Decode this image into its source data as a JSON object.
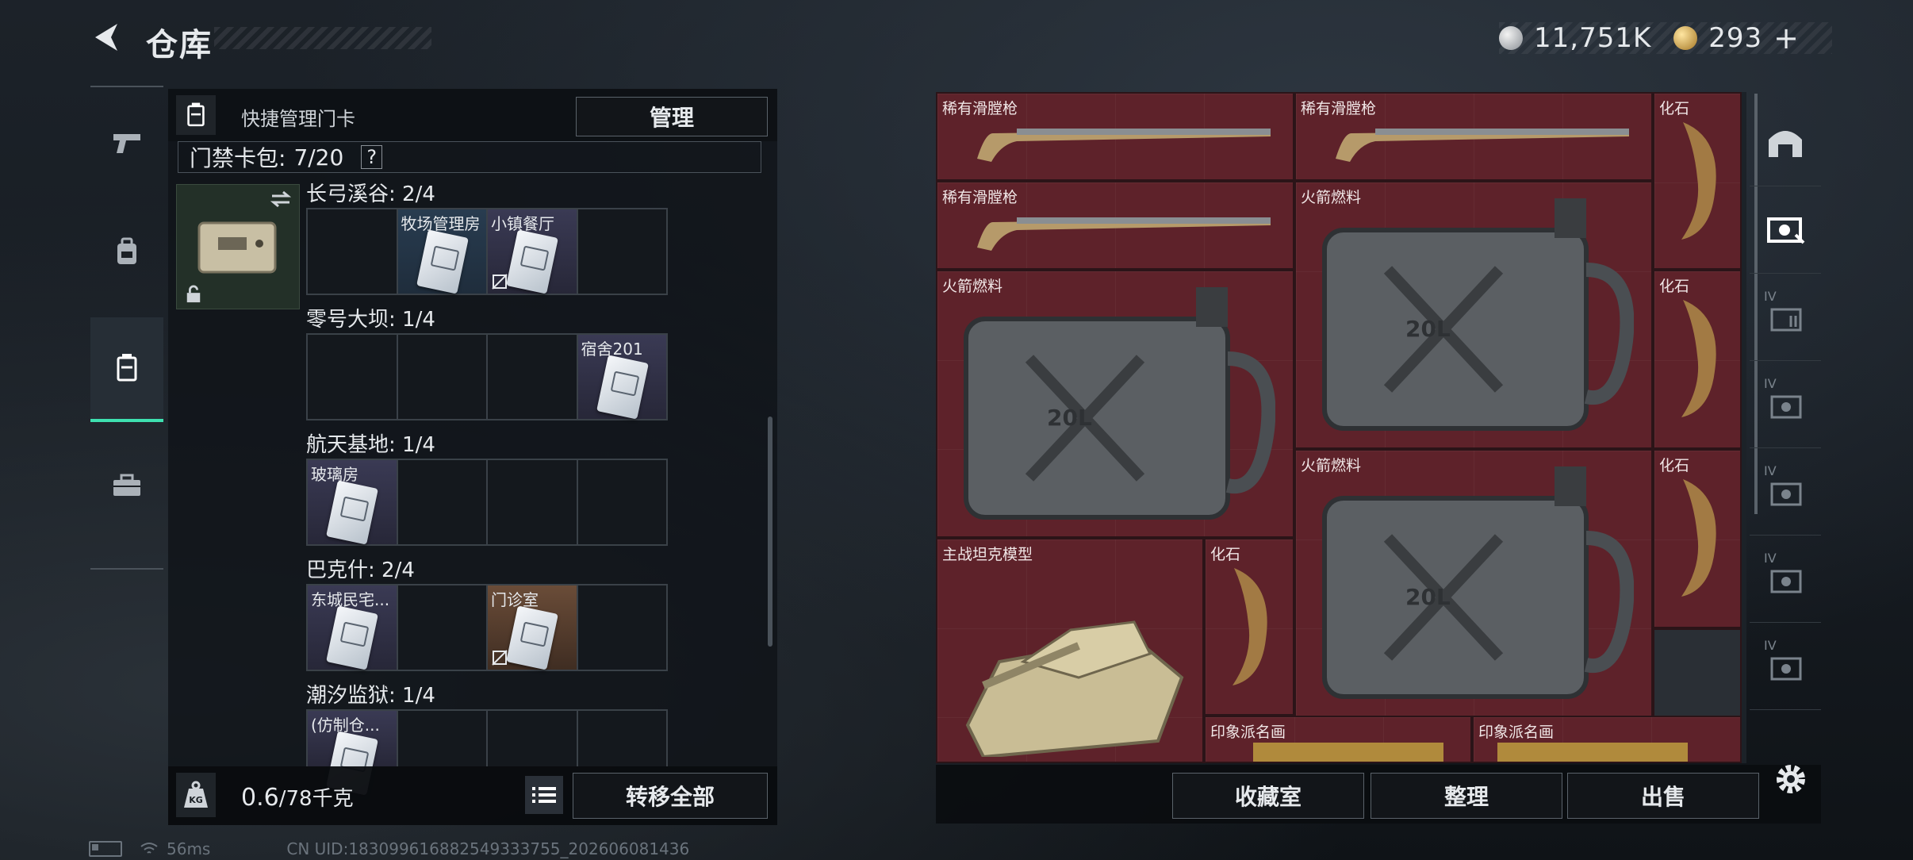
{
  "header": {
    "title": "仓库"
  },
  "currency": {
    "silver": "11,751K",
    "gold": "293",
    "add": "+"
  },
  "nav": {
    "items": [
      "weapons",
      "gear",
      "keycards",
      "toolbox"
    ],
    "active": "keycards"
  },
  "left_panel": {
    "header": "快捷管理门卡",
    "manage": "管理",
    "capacity_label": "门禁卡包:",
    "capacity_value": "7/20",
    "help": "?",
    "maps": [
      {
        "name": "长弓溪谷: 2/4",
        "slots": [
          "",
          "牧场管理房",
          "小镇餐厅",
          ""
        ]
      },
      {
        "name": "零号大坝: 1/4",
        "slots": [
          "",
          "",
          "",
          "宿舍201"
        ]
      },
      {
        "name": "航天基地: 1/4",
        "slots": [
          "玻璃房",
          "",
          "",
          ""
        ]
      },
      {
        "name": "巴克什: 2/4",
        "slots": [
          "东城民宅...",
          "",
          "门诊室",
          ""
        ]
      },
      {
        "name": "潮汐监狱: 1/4",
        "slots": [
          "(仿制仓...",
          "",
          "",
          ""
        ]
      }
    ],
    "weight_value": "0.6",
    "weight_total": "/78千克",
    "transfer_all": "转移全部"
  },
  "stash": {
    "items": {
      "gun1": "稀有滑膛枪",
      "gun2": "稀有滑膛枪",
      "gun3": "稀有滑膛枪",
      "fossil1": "化石",
      "fuel1": "火箭燃料",
      "fuel2": "火箭燃料",
      "fuel3": "火箭燃料",
      "fossil2": "化石",
      "fossil3": "化石",
      "fossil4": "化石",
      "tank": "主战坦克模型",
      "painting1": "印象派名画",
      "painting2": "印象派名画"
    },
    "fuel_mark": "20L"
  },
  "right_nav": {
    "tiers": [
      "IV",
      "IV",
      "IV",
      "IV",
      "IV"
    ]
  },
  "footer": {
    "collection": "收藏室",
    "sort": "整理",
    "sell": "出售"
  },
  "status": {
    "ping": "56ms",
    "uid": "CN UID:183099616882549333755_202606081436"
  },
  "colors": {
    "accent": "#3ee0b0",
    "rare_bg": "#5e222a"
  }
}
